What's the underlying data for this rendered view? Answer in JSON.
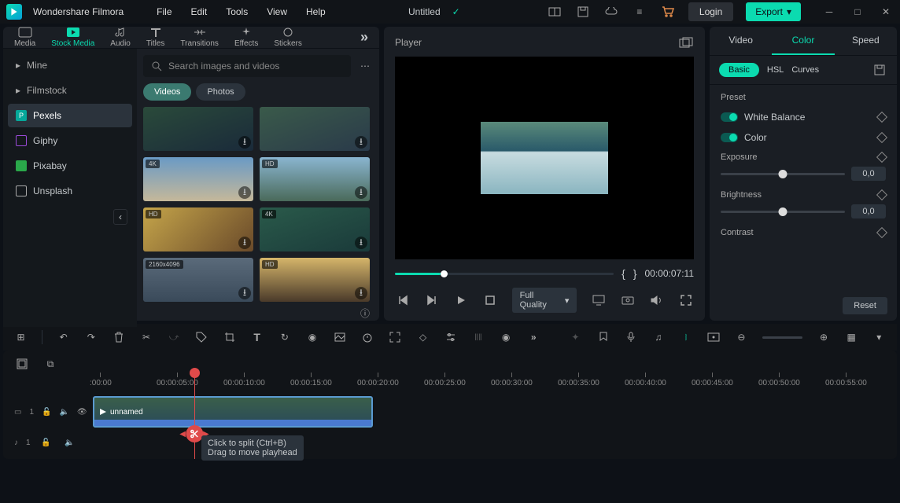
{
  "app": {
    "name": "Wondershare Filmora"
  },
  "menu": [
    "File",
    "Edit",
    "Tools",
    "View",
    "Help"
  ],
  "project": {
    "title": "Untitled"
  },
  "titlebar": {
    "login": "Login",
    "export": "Export"
  },
  "media_tabs": [
    {
      "label": "Media"
    },
    {
      "label": "Stock Media",
      "active": true
    },
    {
      "label": "Audio"
    },
    {
      "label": "Titles"
    },
    {
      "label": "Transitions"
    },
    {
      "label": "Effects"
    },
    {
      "label": "Stickers"
    }
  ],
  "sources": {
    "headers": [
      {
        "label": "Mine"
      },
      {
        "label": "Filmstock"
      }
    ],
    "items": [
      {
        "label": "Pexels",
        "active": true,
        "color": "#05a89a"
      },
      {
        "label": "Giphy",
        "color": "#9a4ad8"
      },
      {
        "label": "Pixabay",
        "color": "#2aa84a"
      },
      {
        "label": "Unsplash",
        "color": "#ddd"
      }
    ]
  },
  "search": {
    "placeholder": "Search images and videos"
  },
  "filters": [
    {
      "label": "Videos",
      "active": true
    },
    {
      "label": "Photos"
    }
  ],
  "thumbs": [
    {
      "badge": ""
    },
    {
      "badge": ""
    },
    {
      "badge": "4K"
    },
    {
      "badge": "HD"
    },
    {
      "badge": "HD"
    },
    {
      "badge": "4K"
    },
    {
      "badge": "2160x4096"
    },
    {
      "badge": "HD"
    }
  ],
  "player": {
    "title": "Player",
    "timecode": "00:00:07:11",
    "quality": "Full Quality"
  },
  "inspector": {
    "tabs": [
      {
        "label": "Video"
      },
      {
        "label": "Color",
        "active": true
      },
      {
        "label": "Speed"
      }
    ],
    "sub": [
      {
        "label": "Basic",
        "pill": true
      },
      {
        "label": "HSL"
      },
      {
        "label": "Curves"
      }
    ],
    "preset": "Preset",
    "toggles": [
      {
        "label": "White Balance"
      },
      {
        "label": "Color"
      }
    ],
    "sliders": [
      {
        "label": "Exposure",
        "value": "0,0"
      },
      {
        "label": "Brightness",
        "value": "0,0"
      },
      {
        "label": "Contrast"
      }
    ],
    "reset": "Reset"
  },
  "timeline": {
    "ticks": [
      ":00:00",
      "00:00:05:00",
      "00:00:10:00",
      "00:00:15:00",
      "00:00:20:00",
      "00:00:25:00",
      "00:00:30:00",
      "00:00:35:00",
      "00:00:40:00",
      "00:00:45:00",
      "00:00:50:00",
      "00:00:55:00"
    ],
    "clip_name": "unnamed",
    "track_video": "1",
    "track_audio": "1",
    "tooltip_line1": "Click to split (Ctrl+B)",
    "tooltip_line2": "Drag to move playhead"
  }
}
